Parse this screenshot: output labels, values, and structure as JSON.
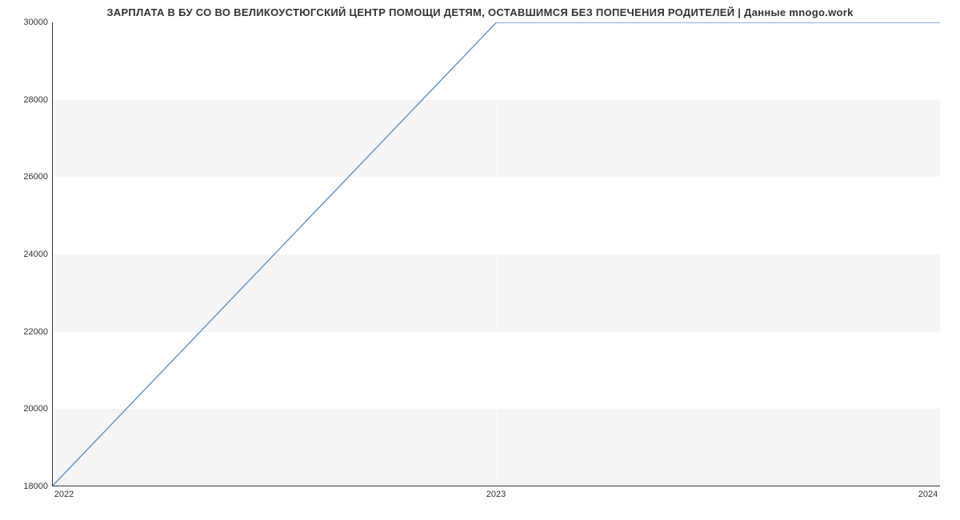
{
  "chart_data": {
    "type": "line",
    "title": "ЗАРПЛАТА В БУ СО ВО ВЕЛИКОУСТЮГСКИЙ ЦЕНТР ПОМОЩИ ДЕТЯМ, ОСТАВШИМСЯ БЕЗ ПОПЕЧЕНИЯ РОДИТЕЛЕЙ | Данные mnogo.work",
    "x": [
      2022,
      2023,
      2024
    ],
    "values": [
      18000,
      30000,
      30000
    ],
    "xlabel": "",
    "ylabel": "",
    "xlim": [
      2022,
      2024
    ],
    "ylim": [
      18000,
      30000
    ],
    "x_ticks": [
      2022,
      2023,
      2024
    ],
    "y_ticks": [
      18000,
      20000,
      22000,
      24000,
      26000,
      28000,
      30000
    ],
    "line_color": "#6699cc"
  }
}
